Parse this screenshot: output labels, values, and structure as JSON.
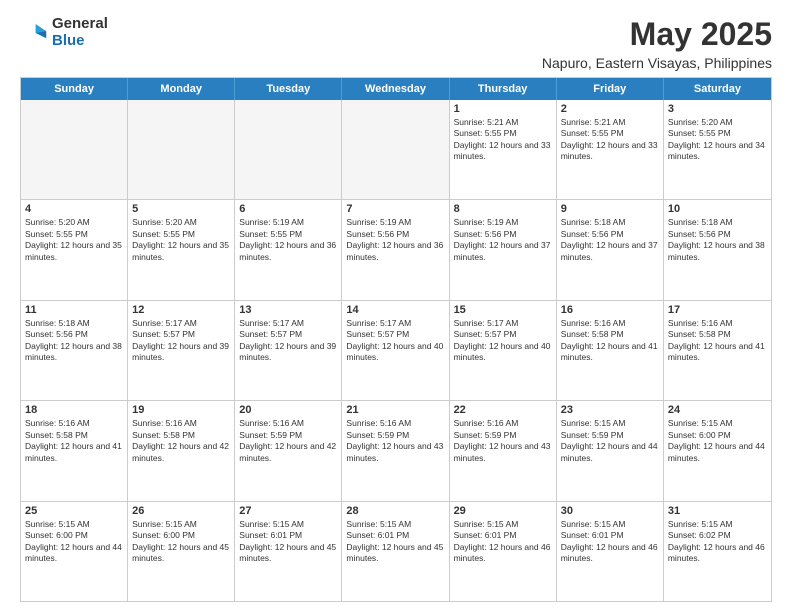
{
  "logo": {
    "general": "General",
    "blue": "Blue"
  },
  "title": {
    "month_year": "May 2025",
    "location": "Napuro, Eastern Visayas, Philippines"
  },
  "weekdays": [
    "Sunday",
    "Monday",
    "Tuesday",
    "Wednesday",
    "Thursday",
    "Friday",
    "Saturday"
  ],
  "rows": [
    [
      {
        "day": "",
        "empty": true
      },
      {
        "day": "",
        "empty": true
      },
      {
        "day": "",
        "empty": true
      },
      {
        "day": "",
        "empty": true
      },
      {
        "day": "1",
        "sunrise": "Sunrise: 5:21 AM",
        "sunset": "Sunset: 5:55 PM",
        "daylight": "Daylight: 12 hours and 33 minutes."
      },
      {
        "day": "2",
        "sunrise": "Sunrise: 5:21 AM",
        "sunset": "Sunset: 5:55 PM",
        "daylight": "Daylight: 12 hours and 33 minutes."
      },
      {
        "day": "3",
        "sunrise": "Sunrise: 5:20 AM",
        "sunset": "Sunset: 5:55 PM",
        "daylight": "Daylight: 12 hours and 34 minutes."
      }
    ],
    [
      {
        "day": "4",
        "sunrise": "Sunrise: 5:20 AM",
        "sunset": "Sunset: 5:55 PM",
        "daylight": "Daylight: 12 hours and 35 minutes."
      },
      {
        "day": "5",
        "sunrise": "Sunrise: 5:20 AM",
        "sunset": "Sunset: 5:55 PM",
        "daylight": "Daylight: 12 hours and 35 minutes."
      },
      {
        "day": "6",
        "sunrise": "Sunrise: 5:19 AM",
        "sunset": "Sunset: 5:55 PM",
        "daylight": "Daylight: 12 hours and 36 minutes."
      },
      {
        "day": "7",
        "sunrise": "Sunrise: 5:19 AM",
        "sunset": "Sunset: 5:56 PM",
        "daylight": "Daylight: 12 hours and 36 minutes."
      },
      {
        "day": "8",
        "sunrise": "Sunrise: 5:19 AM",
        "sunset": "Sunset: 5:56 PM",
        "daylight": "Daylight: 12 hours and 37 minutes."
      },
      {
        "day": "9",
        "sunrise": "Sunrise: 5:18 AM",
        "sunset": "Sunset: 5:56 PM",
        "daylight": "Daylight: 12 hours and 37 minutes."
      },
      {
        "day": "10",
        "sunrise": "Sunrise: 5:18 AM",
        "sunset": "Sunset: 5:56 PM",
        "daylight": "Daylight: 12 hours and 38 minutes."
      }
    ],
    [
      {
        "day": "11",
        "sunrise": "Sunrise: 5:18 AM",
        "sunset": "Sunset: 5:56 PM",
        "daylight": "Daylight: 12 hours and 38 minutes."
      },
      {
        "day": "12",
        "sunrise": "Sunrise: 5:17 AM",
        "sunset": "Sunset: 5:57 PM",
        "daylight": "Daylight: 12 hours and 39 minutes."
      },
      {
        "day": "13",
        "sunrise": "Sunrise: 5:17 AM",
        "sunset": "Sunset: 5:57 PM",
        "daylight": "Daylight: 12 hours and 39 minutes."
      },
      {
        "day": "14",
        "sunrise": "Sunrise: 5:17 AM",
        "sunset": "Sunset: 5:57 PM",
        "daylight": "Daylight: 12 hours and 40 minutes."
      },
      {
        "day": "15",
        "sunrise": "Sunrise: 5:17 AM",
        "sunset": "Sunset: 5:57 PM",
        "daylight": "Daylight: 12 hours and 40 minutes."
      },
      {
        "day": "16",
        "sunrise": "Sunrise: 5:16 AM",
        "sunset": "Sunset: 5:58 PM",
        "daylight": "Daylight: 12 hours and 41 minutes."
      },
      {
        "day": "17",
        "sunrise": "Sunrise: 5:16 AM",
        "sunset": "Sunset: 5:58 PM",
        "daylight": "Daylight: 12 hours and 41 minutes."
      }
    ],
    [
      {
        "day": "18",
        "sunrise": "Sunrise: 5:16 AM",
        "sunset": "Sunset: 5:58 PM",
        "daylight": "Daylight: 12 hours and 41 minutes."
      },
      {
        "day": "19",
        "sunrise": "Sunrise: 5:16 AM",
        "sunset": "Sunset: 5:58 PM",
        "daylight": "Daylight: 12 hours and 42 minutes."
      },
      {
        "day": "20",
        "sunrise": "Sunrise: 5:16 AM",
        "sunset": "Sunset: 5:59 PM",
        "daylight": "Daylight: 12 hours and 42 minutes."
      },
      {
        "day": "21",
        "sunrise": "Sunrise: 5:16 AM",
        "sunset": "Sunset: 5:59 PM",
        "daylight": "Daylight: 12 hours and 43 minutes."
      },
      {
        "day": "22",
        "sunrise": "Sunrise: 5:16 AM",
        "sunset": "Sunset: 5:59 PM",
        "daylight": "Daylight: 12 hours and 43 minutes."
      },
      {
        "day": "23",
        "sunrise": "Sunrise: 5:15 AM",
        "sunset": "Sunset: 5:59 PM",
        "daylight": "Daylight: 12 hours and 44 minutes."
      },
      {
        "day": "24",
        "sunrise": "Sunrise: 5:15 AM",
        "sunset": "Sunset: 6:00 PM",
        "daylight": "Daylight: 12 hours and 44 minutes."
      }
    ],
    [
      {
        "day": "25",
        "sunrise": "Sunrise: 5:15 AM",
        "sunset": "Sunset: 6:00 PM",
        "daylight": "Daylight: 12 hours and 44 minutes."
      },
      {
        "day": "26",
        "sunrise": "Sunrise: 5:15 AM",
        "sunset": "Sunset: 6:00 PM",
        "daylight": "Daylight: 12 hours and 45 minutes."
      },
      {
        "day": "27",
        "sunrise": "Sunrise: 5:15 AM",
        "sunset": "Sunset: 6:01 PM",
        "daylight": "Daylight: 12 hours and 45 minutes."
      },
      {
        "day": "28",
        "sunrise": "Sunrise: 5:15 AM",
        "sunset": "Sunset: 6:01 PM",
        "daylight": "Daylight: 12 hours and 45 minutes."
      },
      {
        "day": "29",
        "sunrise": "Sunrise: 5:15 AM",
        "sunset": "Sunset: 6:01 PM",
        "daylight": "Daylight: 12 hours and 46 minutes."
      },
      {
        "day": "30",
        "sunrise": "Sunrise: 5:15 AM",
        "sunset": "Sunset: 6:01 PM",
        "daylight": "Daylight: 12 hours and 46 minutes."
      },
      {
        "day": "31",
        "sunrise": "Sunrise: 5:15 AM",
        "sunset": "Sunset: 6:02 PM",
        "daylight": "Daylight: 12 hours and 46 minutes."
      }
    ]
  ]
}
